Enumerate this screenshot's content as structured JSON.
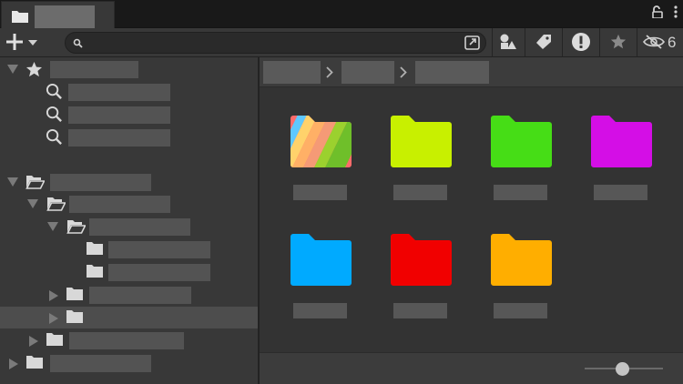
{
  "window": {
    "tab_title": ""
  },
  "toolbar": {
    "search_placeholder": "",
    "hidden_count": "6"
  },
  "tree": {
    "favorites_label": "",
    "favorites": [
      {
        "label": ""
      },
      {
        "label": ""
      },
      {
        "label": ""
      }
    ],
    "assets_label": "",
    "nodes": [
      {
        "label": ""
      },
      {
        "label": ""
      },
      {
        "label": ""
      },
      {
        "label": ""
      },
      {
        "label": ""
      },
      {
        "label": ""
      },
      {
        "label": ""
      },
      {
        "label": ""
      }
    ]
  },
  "breadcrumb": {
    "items": [
      {
        "label": ""
      },
      {
        "label": ""
      },
      {
        "label": ""
      }
    ]
  },
  "grid": {
    "items": [
      {
        "label": "",
        "color": "rainbow"
      },
      {
        "label": "",
        "color": "#c8f000"
      },
      {
        "label": "",
        "color": "#46dd16"
      },
      {
        "label": "",
        "color": "#d40ee6"
      },
      {
        "label": "",
        "color": "#00aaff"
      },
      {
        "label": "",
        "color": "#f10000"
      },
      {
        "label": "",
        "color": "#ffae00"
      }
    ]
  },
  "zoom": {
    "level": 0.5
  }
}
